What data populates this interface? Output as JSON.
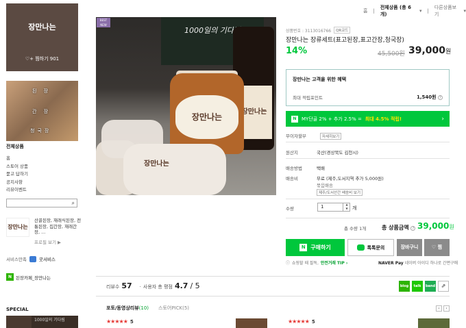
{
  "topnav": {
    "home": "홈",
    "category": "전체상품 (총 6개)",
    "other": "다른상품보기"
  },
  "store": {
    "name": "장만나는",
    "fav": "찜하기 901"
  },
  "banner": {
    "lines": [
      "된 장",
      "간 장",
      "청국장"
    ]
  },
  "sidebar": {
    "title": "전체상품",
    "items": [
      "홈",
      "스토어 상품",
      "묻고 답하기",
      "공지사항",
      "리뷰이벤트"
    ],
    "search_placeholder": ""
  },
  "mini_product": {
    "logo": "장만나는",
    "text": "산골된장, 재래식된장, 전통된장, 집간장, 재래간장, ...",
    "more": "프로필 보기 ▶"
  },
  "service": {
    "label": "서비스만족",
    "value": "굿서비스"
  },
  "cafe": {
    "label": "된장카페_장만나는"
  },
  "special": {
    "title": "SPECIAL",
    "img_text": "1000일의 기다림"
  },
  "photo": {
    "board": "1000일의 기다림",
    "jar": "장만나는",
    "bottle": "장만나는",
    "bag": "장만나는"
  },
  "badge": {
    "line1": "BEST",
    "line2": "NEW"
  },
  "product": {
    "code_label": "상품번호 : 3113016766",
    "code_btn": "QR코드",
    "title": "장만나는 장류세트(표고된장,표고간장,청국장)",
    "discount": "14%",
    "orig_price": "45,500원",
    "price": "39,000",
    "price_unit": "원"
  },
  "benefit": {
    "title": "장만나는 고객을 위한 혜택",
    "label": "최대 적립포인트",
    "value": "1,540원"
  },
  "npay_banner": {
    "n": "N",
    "text1": "MY단골 2% + 추가 2.5% =",
    "text2": "최대 4.5% 적립!",
    "arrow": "›"
  },
  "rows": {
    "interest_label": "무이자할부",
    "interest_btn": "자세히보기",
    "origin_label": "원산지",
    "origin_value": "국산(경상북도 김천시)",
    "ship_label": "배송방법",
    "ship_value": "택배",
    "fee_label": "배송비",
    "fee_value1": "무료 (제주,도서지역 추가 5,000원)",
    "fee_value2": "묶음배송",
    "fee_btn": "제주/도서산간 배송비 보기"
  },
  "qty": {
    "label": "수량",
    "value": "1",
    "unit": "개"
  },
  "total": {
    "count": "총 수량 1개",
    "label": "총 상품금액",
    "price": "39,000",
    "unit": "원"
  },
  "buttons": {
    "buy": "구매하기",
    "talk": "톡톡문의",
    "cart": "장바구니",
    "zzim": "찜"
  },
  "safe": {
    "text": "쇼핑할 때 필독,",
    "link": "안전거래 TIP ›"
  },
  "npay_note": {
    "brand": "NAVER Pay",
    "text": "네이버 아이디 하나로 간편구매"
  },
  "reviews": {
    "count_label": "리뷰수",
    "count": "57",
    "score_label": "사용자 총 평점",
    "score": "4.7",
    "score_max": "/ 5"
  },
  "share": {
    "blog": "blog",
    "talk": "talk",
    "band": "band"
  },
  "tabs": {
    "photo": "포토/동영상리뷰",
    "photo_cnt": "(10)",
    "store": "스토어PICK",
    "store_cnt": "(5)"
  },
  "review_items": [
    {
      "stars": "★★★★★",
      "score": "5"
    },
    {
      "stars": "★★★★★",
      "score": "5"
    }
  ],
  "colors": {
    "accent": "#00c73c",
    "store_box": "#5b4a42",
    "gray_btn": "#8b8b8b"
  }
}
